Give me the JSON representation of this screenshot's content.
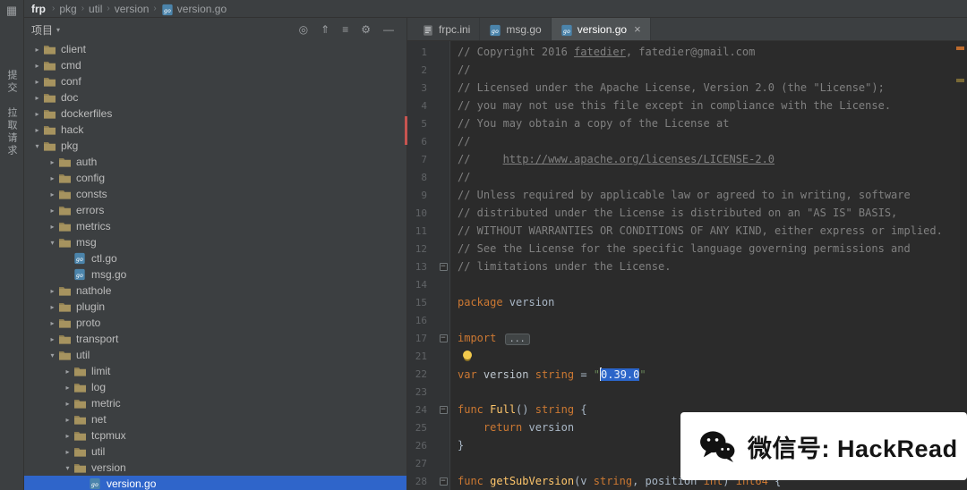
{
  "breadcrumb": {
    "root": "frp",
    "crumbs": [
      "pkg",
      "util",
      "version",
      "version.go"
    ]
  },
  "activity_bar": {
    "tool_icon": "▦",
    "labels": [
      "提交",
      "拉取请求"
    ]
  },
  "project_panel": {
    "title": "项目",
    "title_caret": "▾",
    "icons": [
      {
        "name": "locate-file-icon",
        "glyph": "◎"
      },
      {
        "name": "collapse-all-icon",
        "glyph": "⇑"
      },
      {
        "name": "view-options-icon",
        "glyph": "≡"
      },
      {
        "name": "settings-icon",
        "glyph": "⚙"
      },
      {
        "name": "hide-panel-icon",
        "glyph": "—"
      }
    ],
    "tree": [
      {
        "label": "client",
        "depth": 0,
        "kind": "folder",
        "expanded": false
      },
      {
        "label": "cmd",
        "depth": 0,
        "kind": "folder",
        "expanded": false
      },
      {
        "label": "conf",
        "depth": 0,
        "kind": "folder",
        "expanded": false
      },
      {
        "label": "doc",
        "depth": 0,
        "kind": "folder",
        "expanded": false
      },
      {
        "label": "dockerfiles",
        "depth": 0,
        "kind": "folder",
        "expanded": false
      },
      {
        "label": "hack",
        "depth": 0,
        "kind": "folder",
        "expanded": false
      },
      {
        "label": "pkg",
        "depth": 0,
        "kind": "folder",
        "expanded": true
      },
      {
        "label": "auth",
        "depth": 1,
        "kind": "folder",
        "expanded": false
      },
      {
        "label": "config",
        "depth": 1,
        "kind": "folder",
        "expanded": false
      },
      {
        "label": "consts",
        "depth": 1,
        "kind": "folder",
        "expanded": false
      },
      {
        "label": "errors",
        "depth": 1,
        "kind": "folder",
        "expanded": false
      },
      {
        "label": "metrics",
        "depth": 1,
        "kind": "folder",
        "expanded": false
      },
      {
        "label": "msg",
        "depth": 1,
        "kind": "folder",
        "expanded": true
      },
      {
        "label": "ctl.go",
        "depth": 2,
        "kind": "go"
      },
      {
        "label": "msg.go",
        "depth": 2,
        "kind": "go"
      },
      {
        "label": "nathole",
        "depth": 1,
        "kind": "folder",
        "expanded": false
      },
      {
        "label": "plugin",
        "depth": 1,
        "kind": "folder",
        "expanded": false
      },
      {
        "label": "proto",
        "depth": 1,
        "kind": "folder",
        "expanded": false
      },
      {
        "label": "transport",
        "depth": 1,
        "kind": "folder",
        "expanded": false
      },
      {
        "label": "util",
        "depth": 1,
        "kind": "folder",
        "expanded": true
      },
      {
        "label": "limit",
        "depth": 2,
        "kind": "folder",
        "expanded": false
      },
      {
        "label": "log",
        "depth": 2,
        "kind": "folder",
        "expanded": false
      },
      {
        "label": "metric",
        "depth": 2,
        "kind": "folder",
        "expanded": false
      },
      {
        "label": "net",
        "depth": 2,
        "kind": "folder",
        "expanded": false
      },
      {
        "label": "tcpmux",
        "depth": 2,
        "kind": "folder",
        "expanded": false
      },
      {
        "label": "util",
        "depth": 2,
        "kind": "folder",
        "expanded": false
      },
      {
        "label": "version",
        "depth": 2,
        "kind": "folder",
        "expanded": true
      },
      {
        "label": "version.go",
        "depth": 3,
        "kind": "go",
        "selected": true
      }
    ]
  },
  "tabs": [
    {
      "label": "frpc.ini",
      "icon": "ini",
      "active": false
    },
    {
      "label": "msg.go",
      "icon": "go",
      "active": false
    },
    {
      "label": "version.go",
      "icon": "go",
      "active": true,
      "close": "×"
    }
  ],
  "editor": {
    "lines": [
      {
        "n": 1,
        "segs": [
          [
            "cmt",
            "// Copyright 2016 "
          ],
          [
            "cmt-u",
            "fatedier"
          ],
          [
            "cmt",
            ", fatedier@gmail.com"
          ]
        ]
      },
      {
        "n": 2,
        "segs": [
          [
            "cmt",
            "//"
          ]
        ]
      },
      {
        "n": 3,
        "segs": [
          [
            "cmt",
            "// Licensed under the Apache License, Version 2.0 (the \"License\");"
          ]
        ]
      },
      {
        "n": 4,
        "segs": [
          [
            "cmt",
            "// you may not use this file except in compliance with the License."
          ]
        ]
      },
      {
        "n": 5,
        "segs": [
          [
            "cmt",
            "// You may obtain a copy of the License at"
          ]
        ]
      },
      {
        "n": 6,
        "segs": [
          [
            "cmt",
            "//"
          ]
        ]
      },
      {
        "n": 7,
        "segs": [
          [
            "cmt",
            "//     "
          ],
          [
            "cmt-u",
            "http://www.apache.org/licenses/LICENSE-2.0"
          ]
        ]
      },
      {
        "n": 8,
        "segs": [
          [
            "cmt",
            "//"
          ]
        ]
      },
      {
        "n": 9,
        "segs": [
          [
            "cmt",
            "// Unless required by applicable law or agreed to in writing, software"
          ]
        ]
      },
      {
        "n": 10,
        "segs": [
          [
            "cmt",
            "// distributed under the License is distributed on an \"AS IS\" BASIS,"
          ]
        ]
      },
      {
        "n": 11,
        "segs": [
          [
            "cmt",
            "// WITHOUT WARRANTIES OR CONDITIONS OF ANY KIND, either express or implied."
          ]
        ]
      },
      {
        "n": 12,
        "segs": [
          [
            "cmt",
            "// See the License for the specific language governing permissions and"
          ]
        ]
      },
      {
        "n": 13,
        "segs": [
          [
            "cmt",
            "// limitations under the License."
          ]
        ],
        "fold": true
      },
      {
        "n": 14,
        "segs": []
      },
      {
        "n": 15,
        "segs": [
          [
            "kw",
            "package"
          ],
          [
            "pl",
            " version"
          ]
        ]
      },
      {
        "n": 16,
        "segs": []
      },
      {
        "n": 17,
        "segs": [
          [
            "kw",
            "import"
          ],
          [
            "pl",
            " "
          ],
          [
            "fold",
            "..."
          ]
        ],
        "fold": true
      },
      {
        "n": 21,
        "segs": [],
        "bulb": true
      },
      {
        "n": 22,
        "segs": [
          [
            "kw",
            "var"
          ],
          [
            "pl",
            " "
          ],
          [
            "id",
            "version"
          ],
          [
            "pl",
            " "
          ],
          [
            "kw",
            "string"
          ],
          [
            "pl",
            " = "
          ],
          [
            "str",
            "\""
          ],
          [
            "caret",
            ""
          ],
          [
            "sel",
            "0.39.0"
          ],
          [
            "str",
            "\""
          ]
        ]
      },
      {
        "n": 23,
        "segs": []
      },
      {
        "n": 24,
        "segs": [
          [
            "kw",
            "func"
          ],
          [
            "pl",
            " "
          ],
          [
            "fn",
            "Full"
          ],
          [
            "pl",
            "() "
          ],
          [
            "kw",
            "string"
          ],
          [
            "pl",
            " {"
          ]
        ],
        "fold": true
      },
      {
        "n": 25,
        "segs": [
          [
            "pl",
            "    "
          ],
          [
            "kw",
            "return"
          ],
          [
            "pl",
            " version"
          ]
        ]
      },
      {
        "n": 26,
        "segs": [
          [
            "pl",
            "}"
          ]
        ]
      },
      {
        "n": 27,
        "segs": []
      },
      {
        "n": 28,
        "segs": [
          [
            "kw",
            "func"
          ],
          [
            "pl",
            " "
          ],
          [
            "fn",
            "getSubVersion"
          ],
          [
            "pl",
            "(v "
          ],
          [
            "kw",
            "string"
          ],
          [
            "pl",
            ", position "
          ],
          [
            "kw",
            "int"
          ],
          [
            "pl",
            ") "
          ],
          [
            "kw",
            "int64"
          ],
          [
            "pl",
            " {"
          ]
        ],
        "fold": true
      }
    ]
  },
  "watermark": {
    "text": "微信号: HackRead"
  },
  "colors": {
    "panel_bg": "#3c3f41",
    "editor_bg": "#2b2b2b",
    "selection_blue": "#2f65ca",
    "keyword_orange": "#cc7832",
    "string_green": "#6a8759",
    "comment_gray": "#808080",
    "function_yellow": "#ffc66b",
    "accent_red": "#c75450",
    "bulb_yellow": "#f2c94c"
  }
}
